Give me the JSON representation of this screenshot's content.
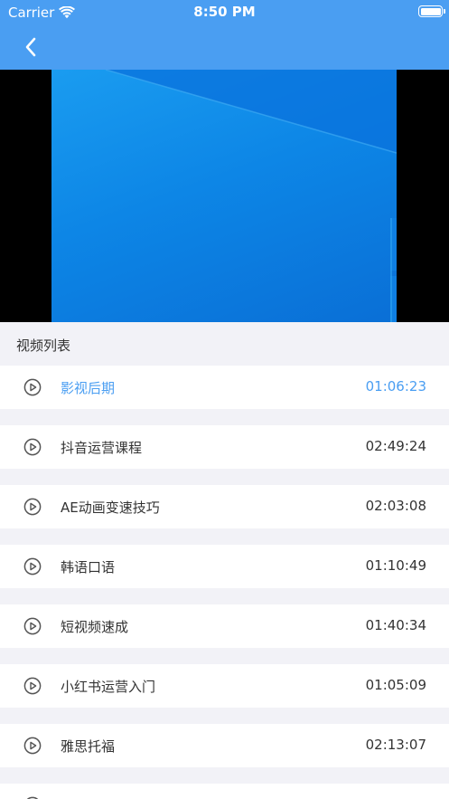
{
  "status_bar": {
    "carrier": "Carrier",
    "time": "8:50 PM"
  },
  "nav": {
    "back_icon": "chevron-left-icon"
  },
  "colors": {
    "accent": "#4a9ef2",
    "text": "#333333",
    "background": "#f2f2f7"
  },
  "section": {
    "title": "视频列表"
  },
  "videos": [
    {
      "title": "影视后期",
      "duration": "01:06:23",
      "active": true
    },
    {
      "title": "抖音运营课程",
      "duration": "02:49:24",
      "active": false
    },
    {
      "title": "AE动画变速技巧",
      "duration": "02:03:08",
      "active": false
    },
    {
      "title": "韩语口语",
      "duration": "01:10:49",
      "active": false
    },
    {
      "title": "短视频速成",
      "duration": "01:40:34",
      "active": false
    },
    {
      "title": "小红书运营入门",
      "duration": "01:05:09",
      "active": false
    },
    {
      "title": "雅思托福",
      "duration": "02:13:07",
      "active": false
    },
    {
      "title": "",
      "duration": "",
      "active": false
    }
  ]
}
